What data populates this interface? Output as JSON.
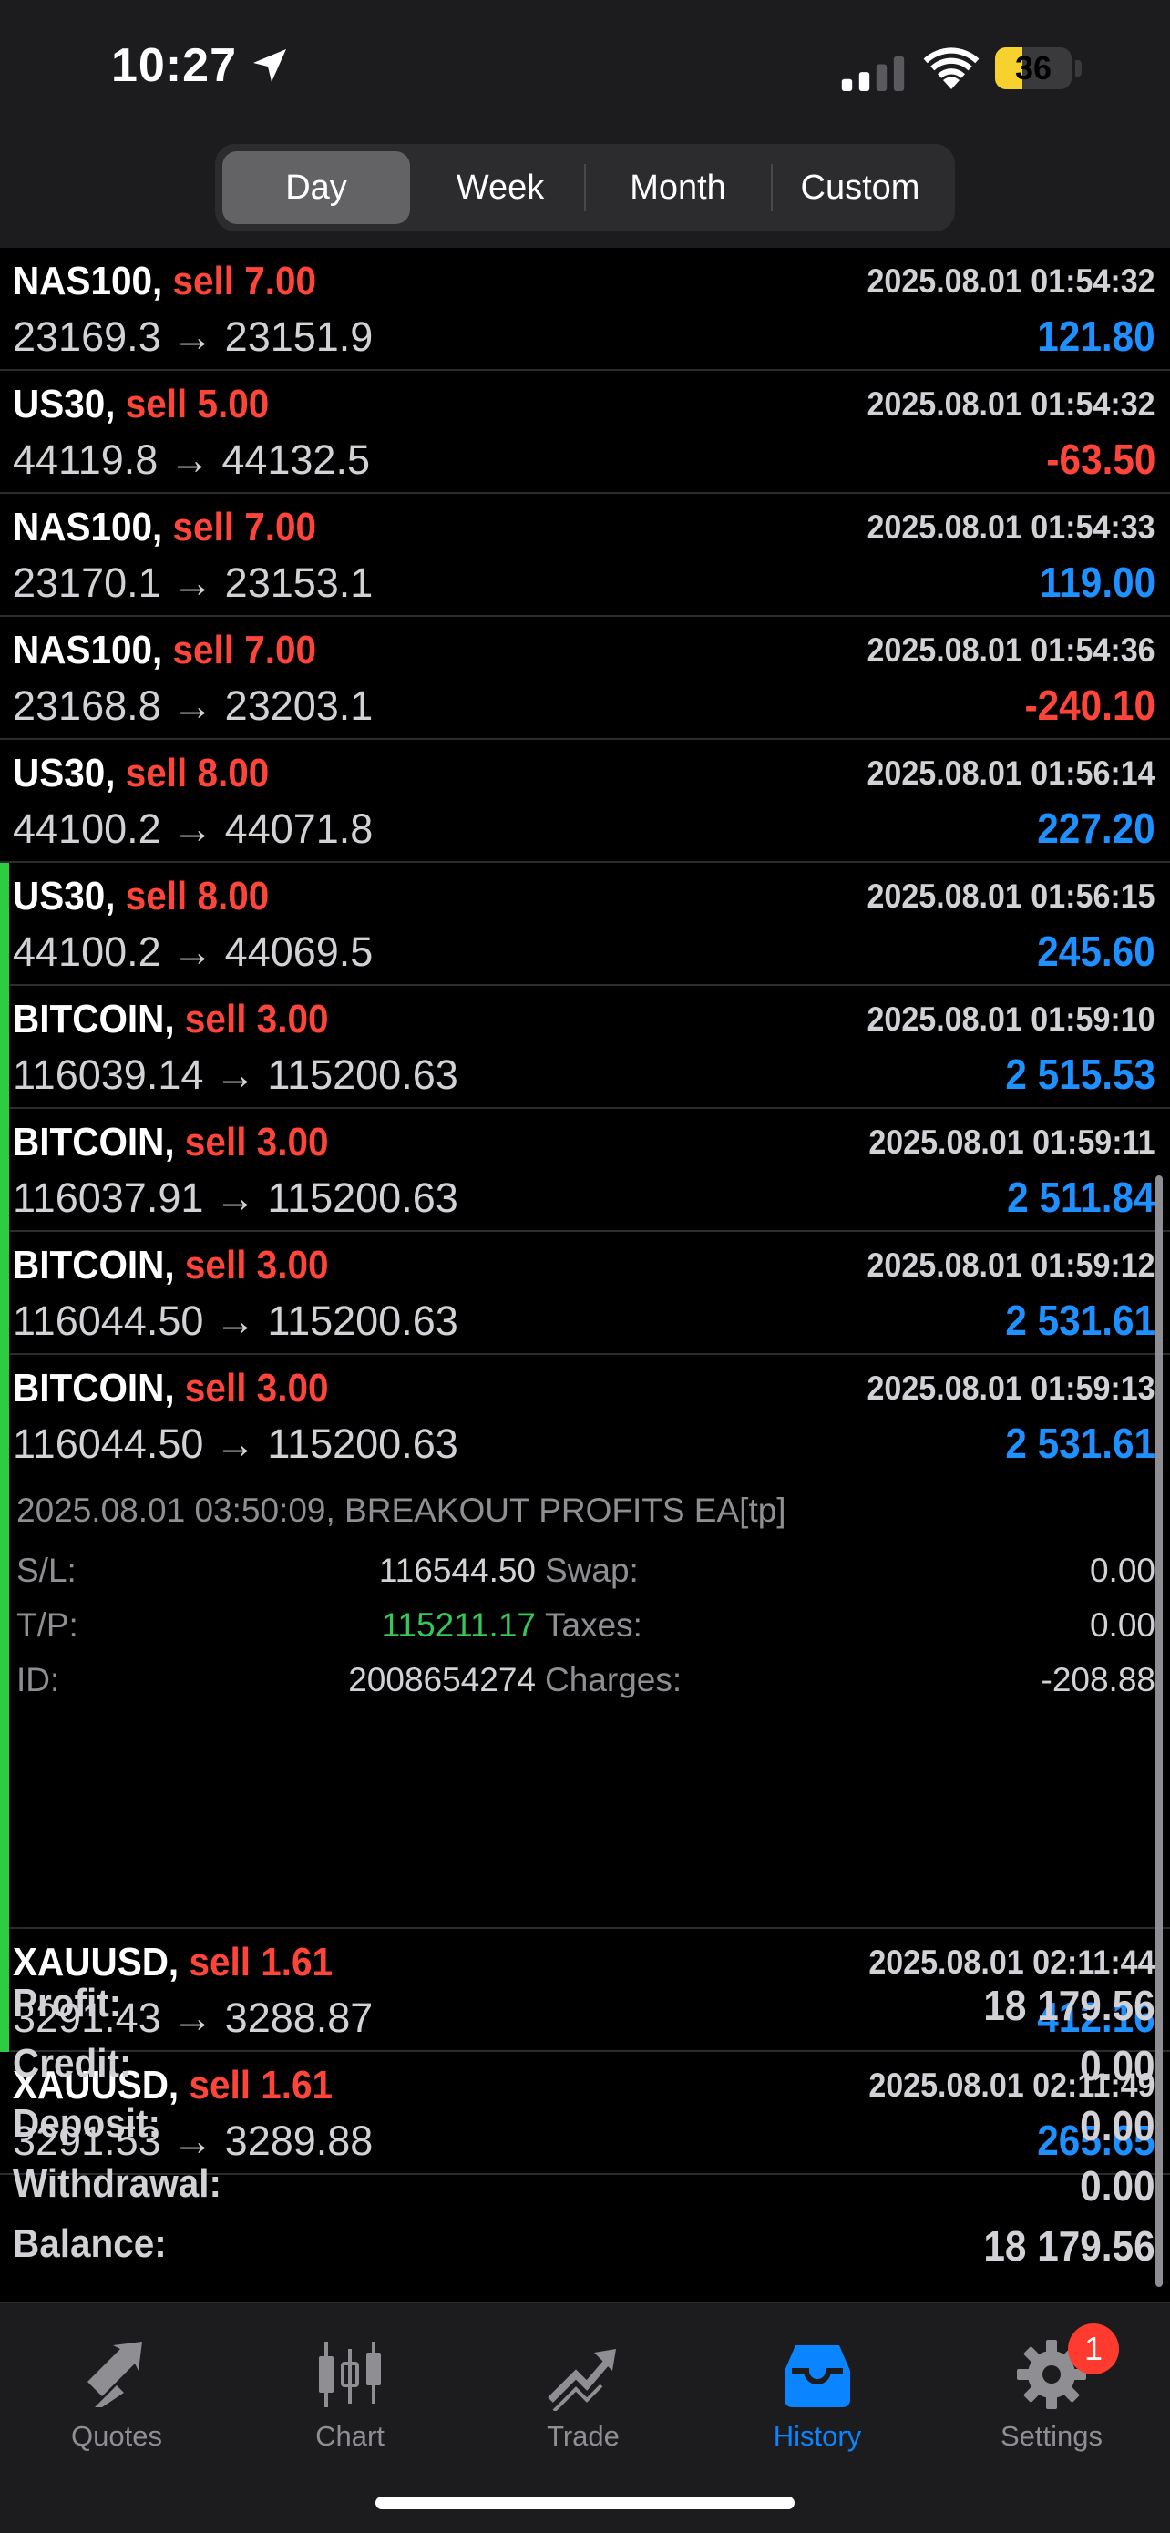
{
  "status": {
    "time": "10:27",
    "battery": "36",
    "battery_level": 0.36
  },
  "filter": {
    "tabs": [
      "Day",
      "Week",
      "Month",
      "Custom"
    ],
    "selected": "Day"
  },
  "deals": [
    {
      "symbol": "NAS100,",
      "side": "sell 7.00",
      "time": "2025.08.01 01:54:32",
      "prices": "23169.3 → 23151.9",
      "profit": "121.80",
      "profit_sign": "pos"
    },
    {
      "symbol": "US30,",
      "side": "sell 5.00",
      "time": "2025.08.01 01:54:32",
      "prices": "44119.8 → 44132.5",
      "profit": "-63.50",
      "profit_sign": "neg"
    },
    {
      "symbol": "NAS100,",
      "side": "sell 7.00",
      "time": "2025.08.01 01:54:33",
      "prices": "23170.1 → 23153.1",
      "profit": "119.00",
      "profit_sign": "pos"
    },
    {
      "symbol": "NAS100,",
      "side": "sell 7.00",
      "time": "2025.08.01 01:54:36",
      "prices": "23168.8 → 23203.1",
      "profit": "-240.10",
      "profit_sign": "neg"
    },
    {
      "symbol": "US30,",
      "side": "sell 8.00",
      "time": "2025.08.01 01:56:14",
      "prices": "44100.2 → 44071.8",
      "profit": "227.20",
      "profit_sign": "pos"
    },
    {
      "symbol": "US30,",
      "side": "sell 8.00",
      "time": "2025.08.01 01:56:15",
      "prices": "44100.2 → 44069.5",
      "profit": "245.60",
      "profit_sign": "pos"
    },
    {
      "symbol": "BITCOIN,",
      "side": "sell 3.00",
      "time": "2025.08.01 01:59:10",
      "prices": "116039.14 → 115200.63",
      "profit": "2 515.53",
      "profit_sign": "pos"
    },
    {
      "symbol": "BITCOIN,",
      "side": "sell 3.00",
      "time": "2025.08.01 01:59:11",
      "prices": "116037.91 → 115200.63",
      "profit": "2 511.84",
      "profit_sign": "pos"
    },
    {
      "symbol": "BITCOIN,",
      "side": "sell 3.00",
      "time": "2025.08.01 01:59:12",
      "prices": "116044.50 → 115200.63",
      "profit": "2 531.61",
      "profit_sign": "pos"
    },
    {
      "symbol": "BITCOIN,",
      "side": "sell 3.00",
      "time": "2025.08.01 01:59:13",
      "prices": "116044.50 → 115200.63",
      "profit": "2 531.61",
      "profit_sign": "pos"
    },
    {
      "symbol": "XAUUSD,",
      "side": "sell 1.61",
      "time": "2025.08.01 02:11:44",
      "prices": "3291.43 → 3288.87",
      "profit": "412.16",
      "profit_sign": "pos"
    },
    {
      "symbol": "XAUUSD,",
      "side": "sell 1.61",
      "time": "2025.08.01 02:11:49",
      "prices": "3291.53 → 3289.88",
      "profit": "265.65",
      "profit_sign": "pos"
    }
  ],
  "expanded": {
    "comment": "2025.08.01 03:50:09, BREAKOUT PROFITS EA[tp]",
    "sl_label": "S/L:",
    "sl": "116544.50",
    "tp_label": "T/P:",
    "tp": "115211.17",
    "id_label": "ID:",
    "id": "2008654274",
    "swap_label": "Swap:",
    "swap": "0.00",
    "taxes_label": "Taxes:",
    "taxes": "0.00",
    "charges_label": "Charges:",
    "charges": "-208.88"
  },
  "totals": {
    "profit_label": "Profit:",
    "profit": "18 179.56",
    "credit_label": "Credit:",
    "credit": "0.00",
    "deposit_label": "Deposit:",
    "deposit": "0.00",
    "withdrawal_label": "Withdrawal:",
    "withdrawal": "0.00",
    "balance_label": "Balance:",
    "balance": "18 179.56"
  },
  "tabbar": {
    "quotes": "Quotes",
    "chart": "Chart",
    "trade": "Trade",
    "history": "History",
    "settings": "Settings",
    "settings_badge": "1",
    "active": "history"
  },
  "colors": {
    "profit_positive": "#1e90ff",
    "profit_negative": "#ff453a",
    "sell": "#ff453a",
    "tp_green": "#34c759",
    "accent": "#0a84ff"
  }
}
